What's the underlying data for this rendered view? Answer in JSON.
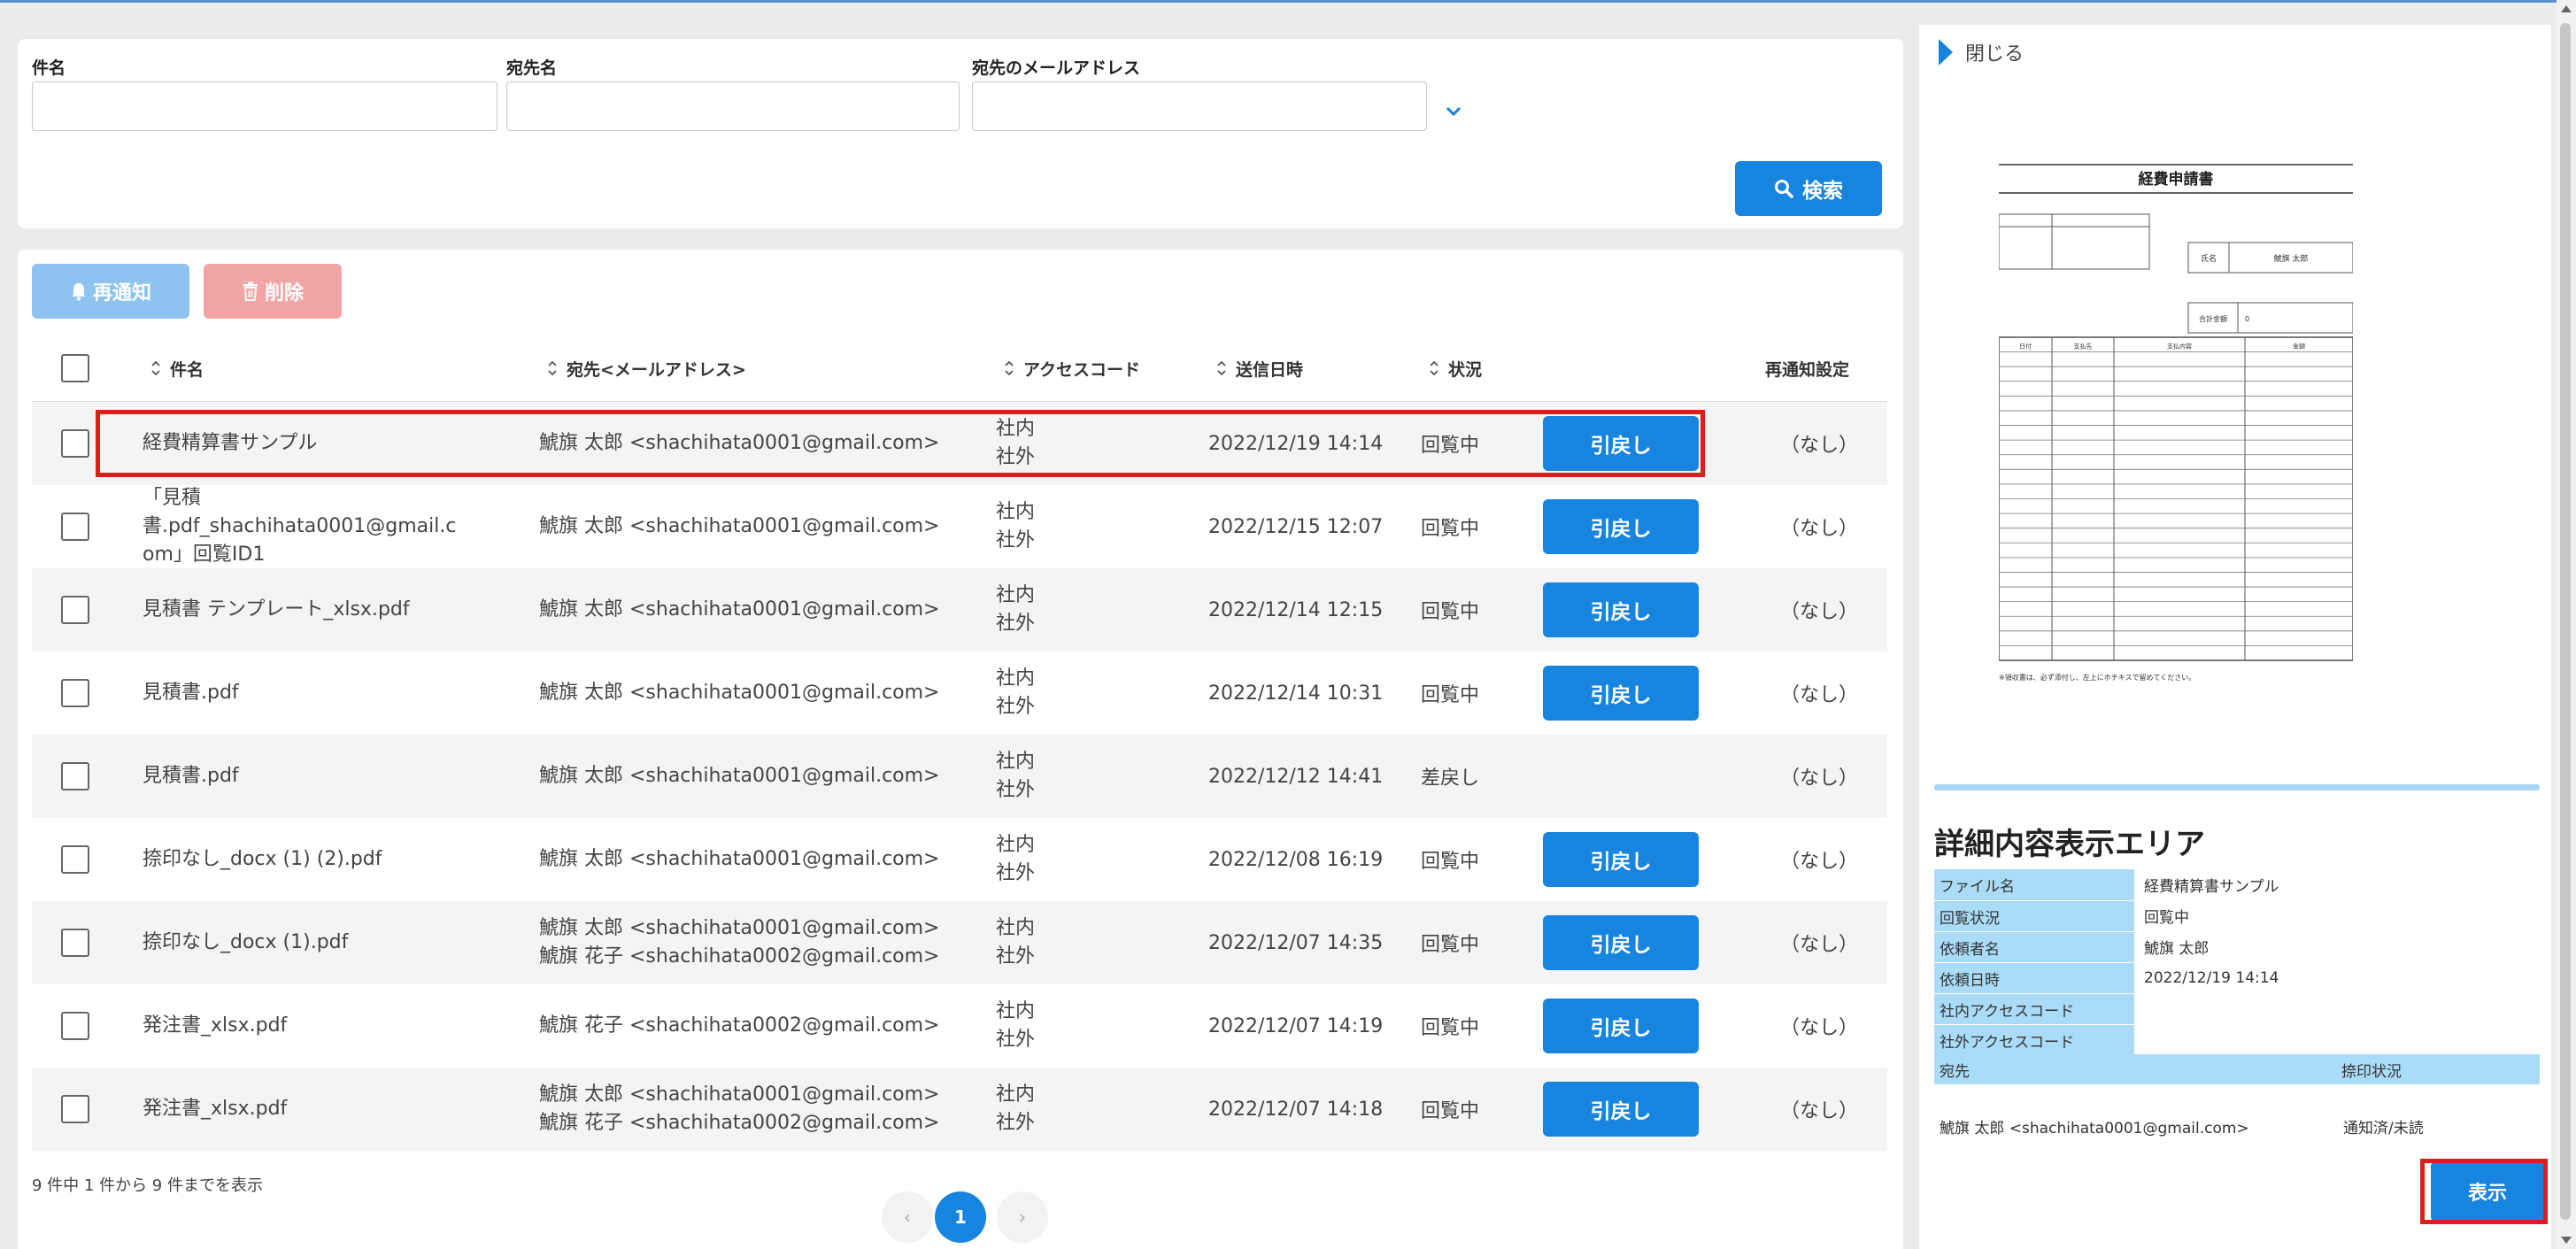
{
  "search": {
    "subject_label": "件名",
    "dest_name_label": "宛先名",
    "dest_email_label": "宛先のメールアドレス",
    "subject_value": "",
    "dest_name_value": "",
    "dest_email_value": "",
    "search_button": "検索"
  },
  "toolbar": {
    "renotify_button": "再通知",
    "delete_button": "削除"
  },
  "table": {
    "headers": {
      "subject": "件名",
      "destination": "宛先<メールアドレス>",
      "access_code": "アクセスコード",
      "sent_date": "送信日時",
      "status": "状況",
      "renotify": "再通知設定"
    },
    "rows": [
      {
        "subject": [
          "経費精算書サンプル"
        ],
        "dest": [
          "鯱旗 太郎 <shachihata0001@gmail.com>"
        ],
        "access": [
          "社内",
          "社外"
        ],
        "date": "2022/12/19 14:14",
        "status": "回覧中",
        "recall": "引戻し",
        "renotify": "（なし）"
      },
      {
        "subject": [
          "「見積書.pdf_shachihata0001@gmail.c",
          "om」回覧ID1"
        ],
        "dest": [
          "鯱旗 太郎 <shachihata0001@gmail.com>"
        ],
        "access": [
          "社内",
          "社外"
        ],
        "date": "2022/12/15 12:07",
        "status": "回覧中",
        "recall": "引戻し",
        "renotify": "（なし）"
      },
      {
        "subject": [
          "見積書 テンプレート_xlsx.pdf"
        ],
        "dest": [
          "鯱旗 太郎 <shachihata0001@gmail.com>"
        ],
        "access": [
          "社内",
          "社外"
        ],
        "date": "2022/12/14 12:15",
        "status": "回覧中",
        "recall": "引戻し",
        "renotify": "（なし）"
      },
      {
        "subject": [
          "見積書.pdf"
        ],
        "dest": [
          "鯱旗 太郎 <shachihata0001@gmail.com>"
        ],
        "access": [
          "社内",
          "社外"
        ],
        "date": "2022/12/14 10:31",
        "status": "回覧中",
        "recall": "引戻し",
        "renotify": "（なし）"
      },
      {
        "subject": [
          "見積書.pdf"
        ],
        "dest": [
          "鯱旗 太郎 <shachihata0001@gmail.com>"
        ],
        "access": [
          "社内",
          "社外"
        ],
        "date": "2022/12/12 14:41",
        "status": "差戻し",
        "recall": "",
        "renotify": "（なし）"
      },
      {
        "subject": [
          "捺印なし_docx (1) (2).pdf"
        ],
        "dest": [
          "鯱旗 太郎 <shachihata0001@gmail.com>"
        ],
        "access": [
          "社内",
          "社外"
        ],
        "date": "2022/12/08 16:19",
        "status": "回覧中",
        "recall": "引戻し",
        "renotify": "（なし）"
      },
      {
        "subject": [
          "捺印なし_docx (1).pdf"
        ],
        "dest": [
          "鯱旗 太郎 <shachihata0001@gmail.com>",
          "鯱旗 花子 <shachihata0002@gmail.com>"
        ],
        "access": [
          "社内",
          "社外"
        ],
        "date": "2022/12/07 14:35",
        "status": "回覧中",
        "recall": "引戻し",
        "renotify": "（なし）"
      },
      {
        "subject": [
          "発注書_xlsx.pdf"
        ],
        "dest": [
          "鯱旗 花子 <shachihata0002@gmail.com>"
        ],
        "access": [
          "社内",
          "社外"
        ],
        "date": "2022/12/07 14:19",
        "status": "回覧中",
        "recall": "引戻し",
        "renotify": "（なし）"
      },
      {
        "subject": [
          "発注書_xlsx.pdf"
        ],
        "dest": [
          "鯱旗 太郎 <shachihata0001@gmail.com>",
          "鯱旗 花子 <shachihata0002@gmail.com>"
        ],
        "access": [
          "社内",
          "社外"
        ],
        "date": "2022/12/07 14:18",
        "status": "回覧中",
        "recall": "引戻し",
        "renotify": "（なし）"
      }
    ]
  },
  "pagination": {
    "summary": "9 件中 1 件から 9 件までを表示",
    "prev": "‹",
    "current": "1",
    "next": "›"
  },
  "detail": {
    "close_label": "閉じる",
    "preview_title": "経費申請書",
    "preview_name_label": "氏名",
    "preview_name_value": "鯱旗 太郎",
    "preview_total_label": "合計金額",
    "preview_total_value": "0",
    "preview_col_date": "日付",
    "preview_col_payee": "支払先",
    "preview_col_item": "支払内容",
    "preview_col_amount": "金額",
    "preview_note": "※領収書は、必ず添付し、左上にホチキスで留めてください。",
    "area_title": "詳細内容表示エリア",
    "fields": [
      {
        "label": "ファイル名",
        "value": "経費精算書サンプル"
      },
      {
        "label": "回覧状況",
        "value": "回覧中"
      },
      {
        "label": "依頼者名",
        "value": "鯱旗 太郎"
      },
      {
        "label": "依頼日時",
        "value": "2022/12/19 14:14"
      },
      {
        "label": "社内アクセスコード",
        "value": ""
      },
      {
        "label": "社外アクセスコード",
        "value": ""
      }
    ],
    "dest_header": "宛先",
    "stamp_header": "捺印状況",
    "dest_value": "鯱旗 太郎 <shachihata0001@gmail.com>",
    "stamp_value": "通知済/未読",
    "show_button": "表示"
  },
  "colors": {
    "primary": "#1784e0",
    "highlight": "#e31b1b",
    "info_label_bg": "#aadcf7"
  }
}
